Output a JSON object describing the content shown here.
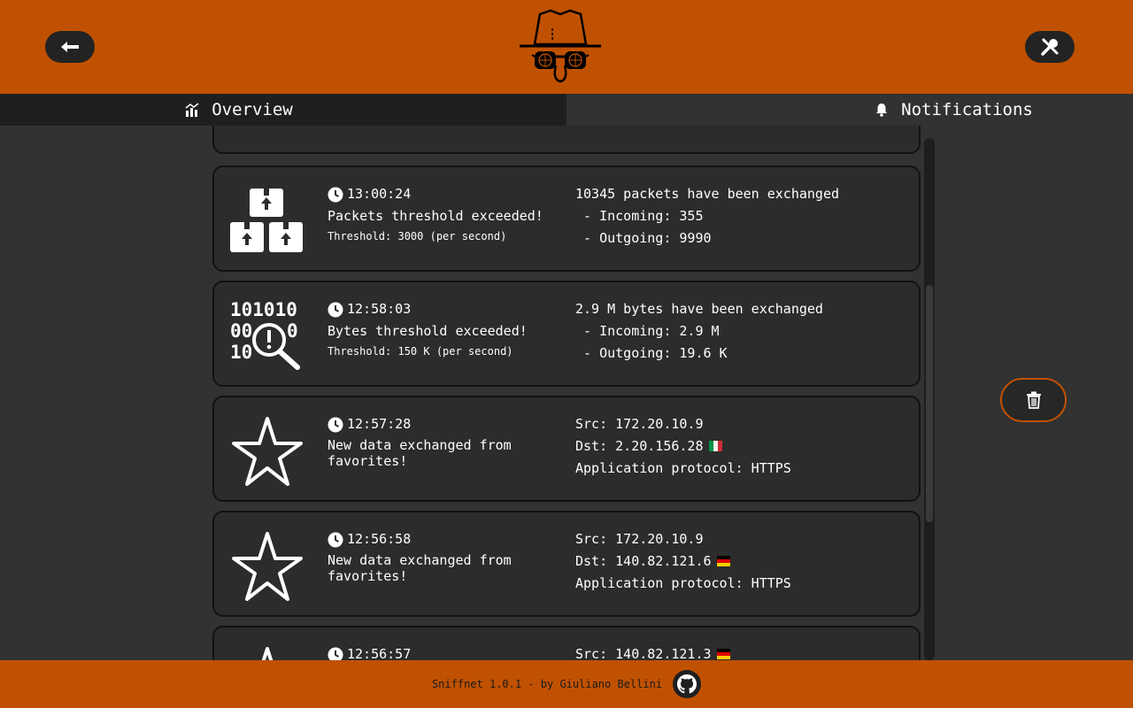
{
  "app": {
    "name": "Sniffnet"
  },
  "header": {
    "back_icon": "arrow-left-icon",
    "settings_icon": "wrench-screwdriver-icon",
    "logo": "sniffnet-spy-logo",
    "colors": {
      "bar": "#c05101",
      "button": "#232323"
    }
  },
  "tabs": [
    {
      "label": "Overview",
      "icon": "chart-icon",
      "active": false
    },
    {
      "label": "Notifications",
      "icon": "bell-icon",
      "active": true
    }
  ],
  "notifications": [
    {
      "icon": "packets-boxes-icon",
      "time": "13:00:24",
      "title": "Packets threshold exceeded!",
      "threshold": "Threshold: 3000 (per second)",
      "details": [
        "10345 packets have been exchanged",
        " - Incoming: 355",
        " - Outgoing: 9990"
      ]
    },
    {
      "icon": "bytes-search-icon",
      "time": "12:58:03",
      "title": "Bytes threshold exceeded!",
      "threshold": "Threshold: 150 K (per second)",
      "details": [
        "2.9 M bytes have been exchanged",
        " - Incoming: 2.9 M",
        " - Outgoing: 19.6 K"
      ]
    },
    {
      "icon": "star-icon",
      "time": "12:57:28",
      "title": "New data exchanged from favorites!",
      "src": "Src: 172.20.10.9",
      "dst": "Dst: 2.20.156.28",
      "dst_flag": "IT",
      "protocol": "Application protocol: HTTPS"
    },
    {
      "icon": "star-icon",
      "time": "12:56:58",
      "title": "New data exchanged from favorites!",
      "src": "Src: 172.20.10.9",
      "dst": "Dst: 140.82.121.6",
      "dst_flag": "DE",
      "protocol": "Application protocol: HTTPS"
    },
    {
      "icon": "star-icon",
      "time": "12:56:57",
      "src": "Src: 140.82.121.3",
      "src_flag": "DE"
    }
  ],
  "side": {
    "clear_icon": "trash-icon",
    "accent": "#c05101"
  },
  "footer": {
    "text": "Sniffnet 1.0.1 - by Giuliano Bellini",
    "icon": "github-icon"
  }
}
